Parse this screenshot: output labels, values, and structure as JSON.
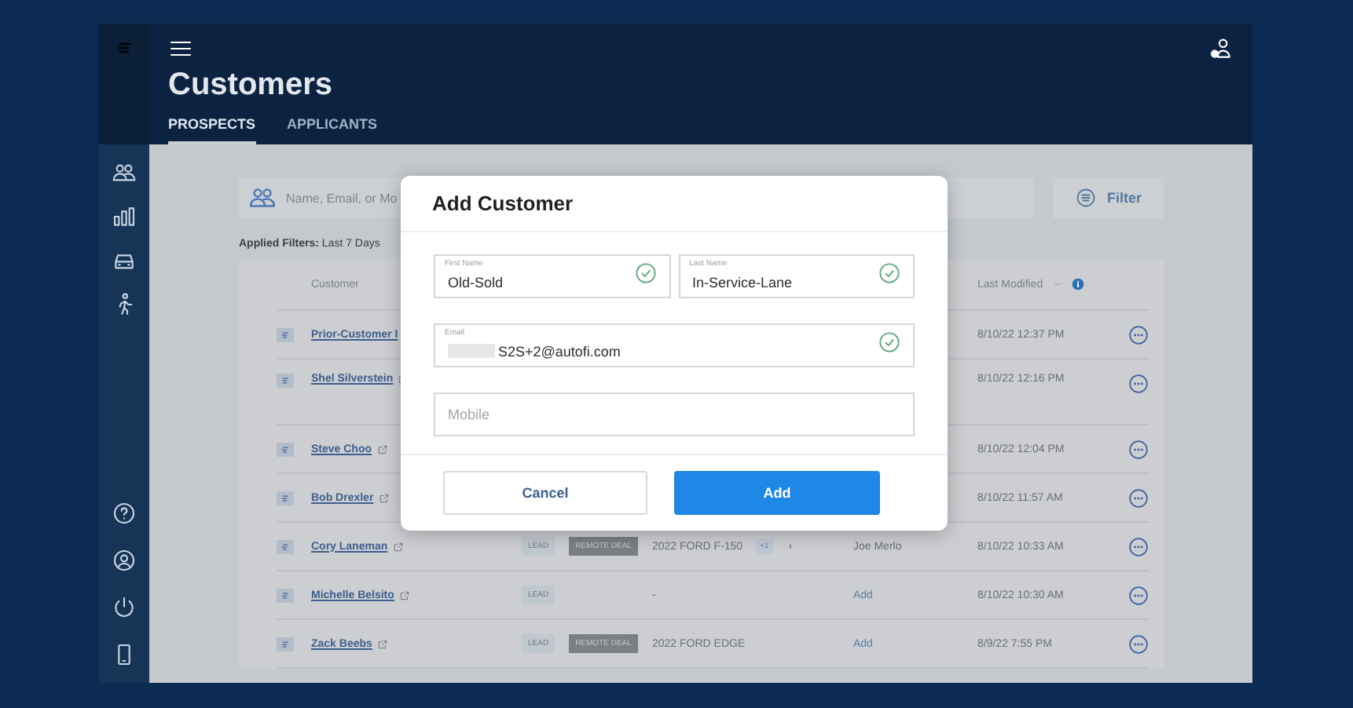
{
  "header": {
    "title": "Customers",
    "tabs": [
      {
        "label": "PROSPECTS",
        "selected": true
      },
      {
        "label": "APPLICANTS",
        "selected": false
      }
    ]
  },
  "search": {
    "placeholder": "Name, Email, or Mo"
  },
  "filter_button": {
    "label": "Filter"
  },
  "applied_filters": {
    "label": "Applied Filters:",
    "value": "Last 7 Days"
  },
  "table": {
    "columns": [
      "Customer",
      "Last Modified"
    ],
    "rows": [
      {
        "customer": "Prior-Customer I",
        "tags": [],
        "vehicle": "",
        "vehicle_extra": "",
        "salesperson": null,
        "modified": "8/10/22 12:37 PM"
      },
      {
        "customer": "Shel Silverstein",
        "tags": [],
        "vehicle": "",
        "vehicle_extra": "",
        "salesperson": null,
        "modified": "8/10/22 12:16 PM"
      },
      {
        "customer": "Steve Choo",
        "tags": [],
        "vehicle": "",
        "vehicle_extra": "",
        "salesperson": null,
        "modified": "8/10/22 12:04 PM"
      },
      {
        "customer": "Bob Drexler",
        "tags": [],
        "vehicle": "",
        "vehicle_extra": "",
        "salesperson": null,
        "modified": "8/10/22 11:57 AM"
      },
      {
        "customer": "Cory Laneman",
        "tags": [
          {
            "label": "LEAD",
            "kind": "lead"
          },
          {
            "label": "REMOTE DEAL",
            "kind": "remote"
          }
        ],
        "vehicle": "2022 FORD F-150",
        "vehicle_extra": "+1",
        "salesperson": {
          "text": "Joe Merlo",
          "kind": "name"
        },
        "modified": "8/10/22 10:33 AM"
      },
      {
        "customer": "Michelle Belsito",
        "tags": [
          {
            "label": "LEAD",
            "kind": "lead"
          }
        ],
        "vehicle": "-",
        "vehicle_extra": "",
        "salesperson": {
          "text": "Add",
          "kind": "add"
        },
        "modified": "8/10/22 10:30 AM"
      },
      {
        "customer": "Zack Beebs",
        "tags": [
          {
            "label": "LEAD",
            "kind": "lead"
          },
          {
            "label": "REMOTE DEAL",
            "kind": "remote"
          }
        ],
        "vehicle": "2022 FORD EDGE",
        "vehicle_extra": "",
        "salesperson": {
          "text": "Add",
          "kind": "add"
        },
        "modified": "8/9/22 7:55 PM"
      }
    ]
  },
  "modal": {
    "title": "Add Customer",
    "field_rows": [
      [
        {
          "label": "First Name",
          "value": "Old-Sold",
          "valid": true,
          "redacted": false
        },
        {
          "label": "Last Name",
          "value": "In-Service-Lane",
          "valid": true,
          "redacted": false
        }
      ],
      [
        {
          "label": "Email",
          "value": "S2S+2@autofi.com",
          "valid": true,
          "redacted": true
        }
      ],
      [
        {
          "placeholder": "Mobile",
          "valid": false
        }
      ]
    ],
    "buttons": [
      {
        "label": "Cancel",
        "kind": "secondary"
      },
      {
        "label": "Add",
        "kind": "primary"
      }
    ]
  }
}
